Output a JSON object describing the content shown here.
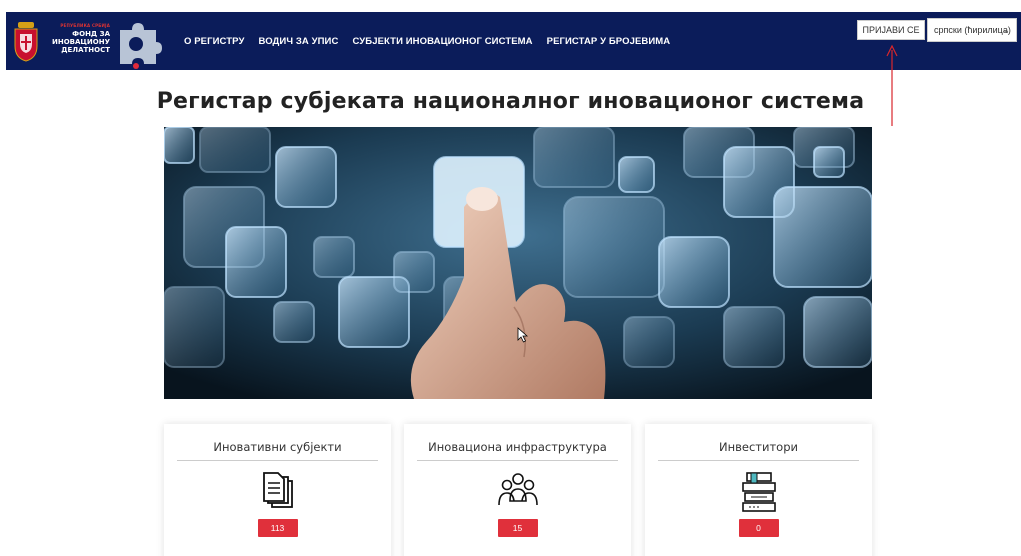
{
  "header": {
    "logo": {
      "line_small": "РЕПУБЛИКА СРБИЈА",
      "lines": [
        "ФОНД ЗА",
        "ИНОВАЦИОНУ",
        "ДЕЛАТНОСТ"
      ]
    },
    "nav": [
      {
        "label": "О РЕГИСТРУ"
      },
      {
        "label": "ВОДИЧ ЗА УПИС"
      },
      {
        "label": "СУБЈЕКТИ ИНОВАЦИОНОГ СИСТЕМА"
      },
      {
        "label": "РЕГИСТАР У БРОЈЕВИМА"
      }
    ],
    "login_label": "ПРИЈАВИ СЕ",
    "language": {
      "selected": "српски (ћирилица)",
      "icon": "chevron-down-icon"
    }
  },
  "page_title": "Регистар субјеката националног иновационог система",
  "cards": [
    {
      "title": "Иновативни субјекти",
      "count": "113",
      "icon": "documents-icon"
    },
    {
      "title": "Иновациона инфраструктура",
      "count": "15",
      "icon": "people-group-icon"
    },
    {
      "title": "Инвеститори",
      "count": "0",
      "icon": "book-stack-icon"
    }
  ],
  "colors": {
    "header_bg": "#0b1c5a",
    "badge_bg": "#e0303b",
    "annotation": "#d9262b"
  }
}
